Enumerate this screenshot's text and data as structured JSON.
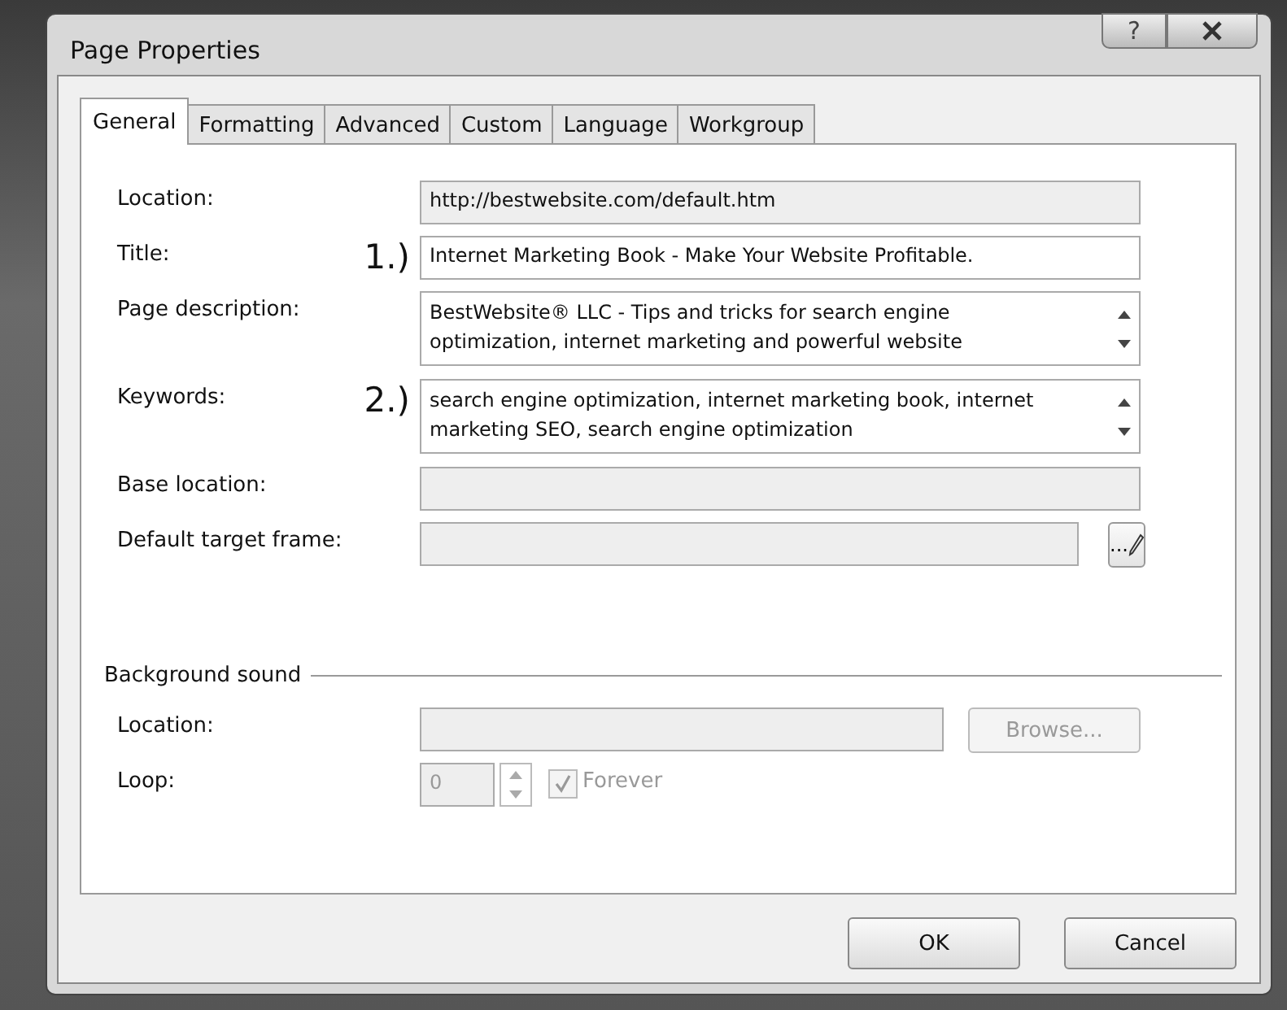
{
  "window": {
    "title": "Page Properties",
    "help_button": "?"
  },
  "tabs": [
    {
      "label": "General",
      "selected": true
    },
    {
      "label": "Formatting",
      "selected": false
    },
    {
      "label": "Advanced",
      "selected": false
    },
    {
      "label": "Custom",
      "selected": false
    },
    {
      "label": "Language",
      "selected": false
    },
    {
      "label": "Workgroup",
      "selected": false
    }
  ],
  "fields": [
    {
      "kind": "text",
      "label": "Location:",
      "value": "http://bestwebsite.com/default.htm",
      "disabled": true
    },
    {
      "kind": "text",
      "label": "Title:",
      "marker": "1.)",
      "value": "Internet Marketing Book - Make Your Website Profitable.",
      "disabled": false
    },
    {
      "kind": "multiline",
      "label": "Page description:",
      "value": "BestWebsite® LLC - Tips and tricks for search engine optimization, internet marketing and powerful website",
      "disabled": false
    },
    {
      "kind": "multiline",
      "label": "Keywords:",
      "marker": "2.)",
      "value": "search engine optimization, internet marketing book, internet marketing SEO, search engine optimization",
      "disabled": false
    },
    {
      "kind": "text",
      "label": "Base location:",
      "disabled": true
    },
    {
      "kind": "picker",
      "label": "Default target frame:",
      "button": "...",
      "disabled": true
    }
  ],
  "background_sound": {
    "heading": "Background sound",
    "location_label": "Location:",
    "browse_button": {
      "label": "Browse...",
      "disabled": true
    },
    "loop_label": "Loop:",
    "loop_value": "0",
    "forever": {
      "label": "Forever",
      "checked": true,
      "disabled": true
    }
  },
  "buttons": [
    {
      "label": "OK"
    },
    {
      "label": "Cancel"
    }
  ]
}
